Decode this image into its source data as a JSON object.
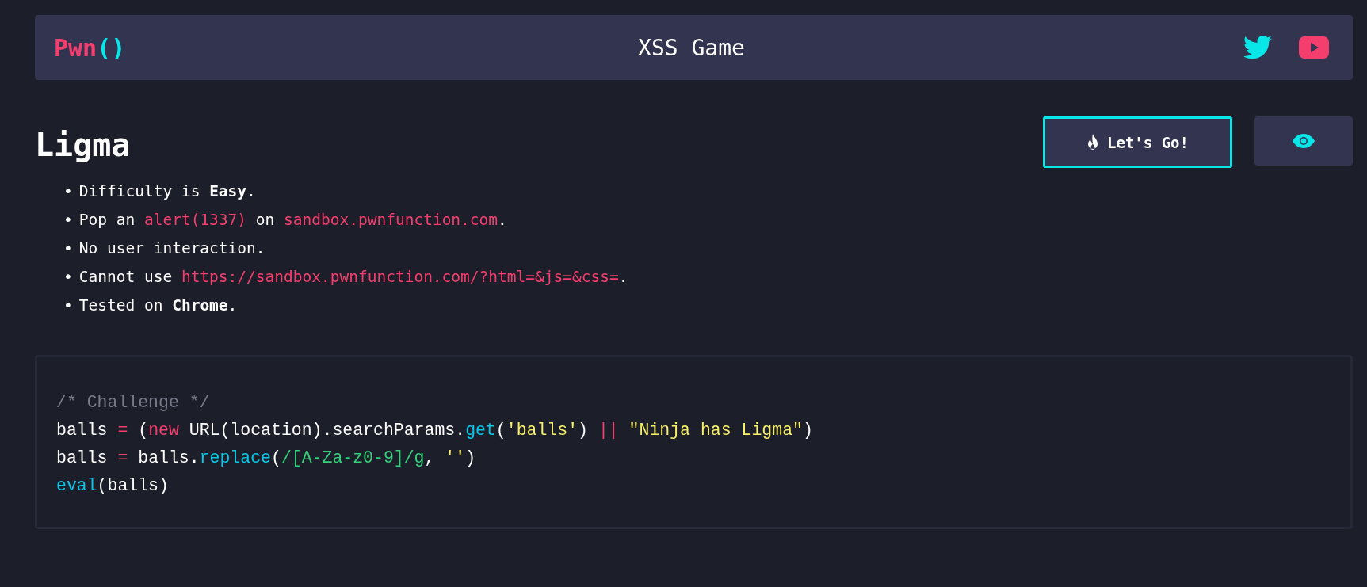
{
  "header": {
    "logo": {
      "text": "Pwn",
      "parens": "()"
    },
    "title": "XSS Game"
  },
  "challenge": {
    "title": "Ligma",
    "start_button": "Let's Go!",
    "rules": [
      {
        "marker": "•",
        "parts": [
          {
            "text": "Difficulty is ",
            "kind": "text"
          },
          {
            "text": "Easy",
            "kind": "bold"
          },
          {
            "text": ".",
            "kind": "text"
          }
        ]
      },
      {
        "marker": "•",
        "parts": [
          {
            "text": "Pop an ",
            "kind": "text"
          },
          {
            "text": "alert(1337)",
            "kind": "code"
          },
          {
            "text": " on ",
            "kind": "text"
          },
          {
            "text": "sandbox.pwnfunction.com",
            "kind": "code"
          },
          {
            "text": ".",
            "kind": "text"
          }
        ]
      },
      {
        "marker": "•",
        "parts": [
          {
            "text": "No user interaction.",
            "kind": "text"
          }
        ]
      },
      {
        "marker": "•",
        "parts": [
          {
            "text": "Cannot use ",
            "kind": "text"
          },
          {
            "text": "https://sandbox.pwnfunction.com/?html=&js=&css=",
            "kind": "code"
          },
          {
            "text": ".",
            "kind": "text"
          }
        ]
      },
      {
        "marker": "•",
        "parts": [
          {
            "text": "Tested on ",
            "kind": "text"
          },
          {
            "text": "Chrome",
            "kind": "bold"
          },
          {
            "text": ".",
            "kind": "text"
          }
        ]
      }
    ]
  },
  "code": [
    [
      {
        "text": "/* Challenge */",
        "kind": "comment"
      }
    ],
    [
      {
        "text": "balls ",
        "kind": "plain"
      },
      {
        "text": "=",
        "kind": "keyword"
      },
      {
        "text": " (",
        "kind": "plain"
      },
      {
        "text": "new",
        "kind": "keyword"
      },
      {
        "text": " URL(location).searchParams.",
        "kind": "plain"
      },
      {
        "text": "get",
        "kind": "func"
      },
      {
        "text": "(",
        "kind": "plain"
      },
      {
        "text": "'balls'",
        "kind": "string"
      },
      {
        "text": ") ",
        "kind": "plain"
      },
      {
        "text": "|| ",
        "kind": "keyword"
      },
      {
        "text": "\"Ninja has Ligma\"",
        "kind": "string"
      },
      {
        "text": ")",
        "kind": "plain"
      }
    ],
    [
      {
        "text": "balls ",
        "kind": "plain"
      },
      {
        "text": "=",
        "kind": "keyword"
      },
      {
        "text": " balls.",
        "kind": "plain"
      },
      {
        "text": "replace",
        "kind": "func"
      },
      {
        "text": "(",
        "kind": "plain"
      },
      {
        "text": "/[A-Za-z0-9]/g",
        "kind": "regex"
      },
      {
        "text": ", ",
        "kind": "plain"
      },
      {
        "text": "''",
        "kind": "string"
      },
      {
        "text": ")",
        "kind": "plain"
      }
    ],
    [
      {
        "text": "eval",
        "kind": "func"
      },
      {
        "text": "(balls)",
        "kind": "plain"
      }
    ]
  ]
}
